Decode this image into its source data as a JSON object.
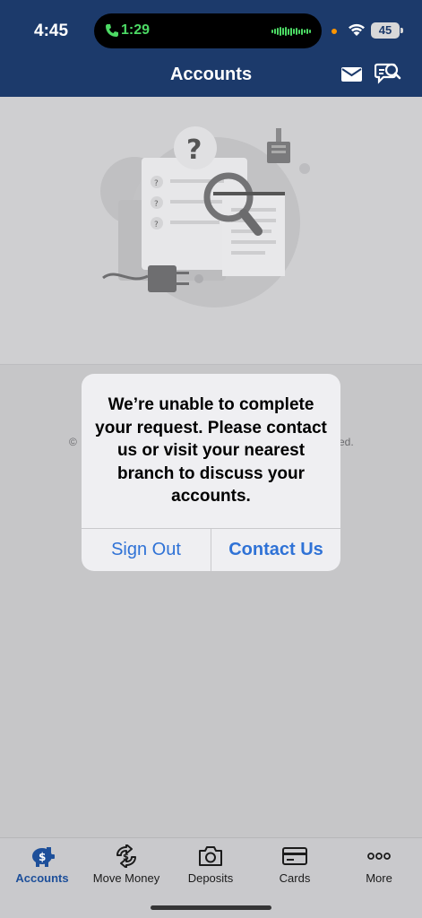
{
  "status_bar": {
    "time": "4:45",
    "call_duration": "1:29",
    "battery": "45"
  },
  "header": {
    "title": "Accounts",
    "icons": [
      "mail-icon",
      "chat-search-icon"
    ]
  },
  "footer": {
    "left_fragment": "©",
    "right_fragment": "ed."
  },
  "alert": {
    "message": "We’re unable to complete your request. Please contact us or visit your nearest branch to discuss your accounts.",
    "sign_out_label": "Sign Out",
    "contact_label": "Contact Us"
  },
  "tabbar": {
    "tabs": [
      {
        "label": "Accounts",
        "icon": "piggy-bank-icon",
        "active": true
      },
      {
        "label": "Move Money",
        "icon": "transfer-icon",
        "active": false
      },
      {
        "label": "Deposits",
        "icon": "camera-icon",
        "active": false
      },
      {
        "label": "Cards",
        "icon": "card-icon",
        "active": false
      },
      {
        "label": "More",
        "icon": "more-dots-icon",
        "active": false
      }
    ]
  },
  "colors": {
    "header_bg": "#1c3a6b",
    "accent_blue": "#2f72d6",
    "active_tab": "#1d4f9a",
    "call_green": "#4cd964"
  }
}
